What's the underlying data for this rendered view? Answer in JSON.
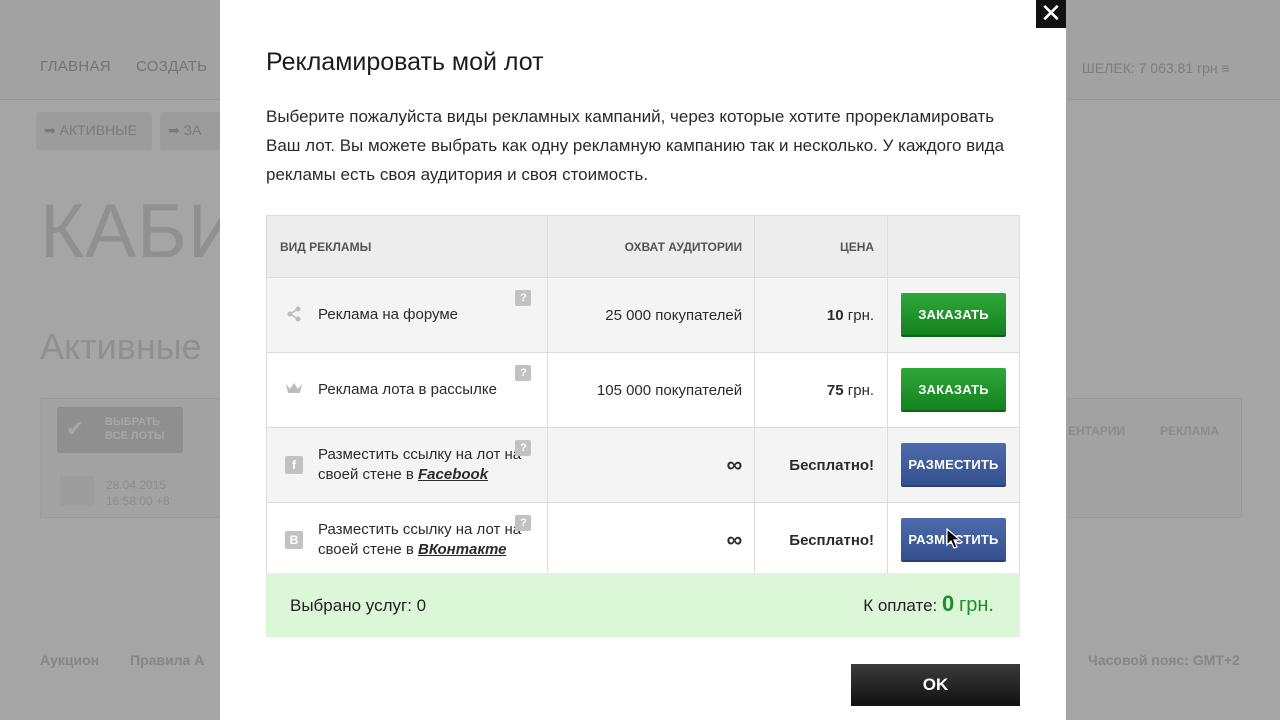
{
  "background": {
    "nav_items": [
      "ГЛАВНАЯ",
      "СОЗДАТЬ"
    ],
    "wallet": "ШЕЛЕК: 7 063.81 грн",
    "top_right": "",
    "subnav": [
      "АКТИВНЫЕ",
      "ЗА"
    ],
    "big_title": "КАБИ",
    "sub_title": "Активные",
    "select_all": "ВЫБРАТЬ ВСЕ ЛОТЫ",
    "date_line1": "28.04.2015",
    "date_line2": "16:58:00 +8",
    "col_comments": "ЕНТАРИИ",
    "col_ads": "РЕКЛАМА",
    "footer_left": [
      "Аукцион",
      "Правила А"
    ],
    "footer_right": "Часовой пояс: GMT+2"
  },
  "modal": {
    "close_symbol": "✕",
    "title": "Рекламировать мой лот",
    "description": "Выберите пожалуйста виды рекламных кампаний, через которые хотите прорекламировать Ваш лот. Вы можете выбрать как одну рекламную кампанию так и несколько. У каждого вида рекламы есть своя аудитория и своя стоимость.",
    "table": {
      "headers": [
        "ВИД РЕКЛАМЫ",
        "ОХВАТ АУДИТОРИИ",
        "ЦЕНА",
        ""
      ],
      "rows": [
        {
          "icon": "share-icon",
          "label": "Реклама на форуме",
          "reach": "25 000 покупателей",
          "price": "10",
          "price_unit": "грн.",
          "button": "ЗАКАЗАТЬ"
        },
        {
          "icon": "crown-icon",
          "label": "Реклама лота в рассылке",
          "reach": "105 000 покупателей",
          "price": "75",
          "price_unit": "грн.",
          "button": "ЗАКАЗАТЬ"
        },
        {
          "icon": "facebook-icon",
          "label_prefix": "Разместить ссылку на лот на своей стене в ",
          "label_link": "Facebook",
          "reach": "∞",
          "price": "Бесплатно!",
          "button": "РАЗМЕСТИТЬ"
        },
        {
          "icon": "vkontakte-icon",
          "label_prefix": "Разместить ссылку на лот на своей стене в ",
          "label_link": "ВКонтакте",
          "reach": "∞",
          "price": "Бесплатно!",
          "button": "РАЗМЕСТИТЬ"
        }
      ],
      "help_symbol": "?"
    },
    "summary": {
      "selected_label": "Выбрано услуг:",
      "selected_count": "0",
      "payment_label": "К оплате:",
      "payment_amount": "0",
      "payment_currency": "грн."
    },
    "ok_label": "OK"
  },
  "colors": {
    "order_button": "#1f9a2b",
    "place_button": "#3f5c9c",
    "summary_bg": "#dcf7d8",
    "amount": "#1b8f2a"
  }
}
